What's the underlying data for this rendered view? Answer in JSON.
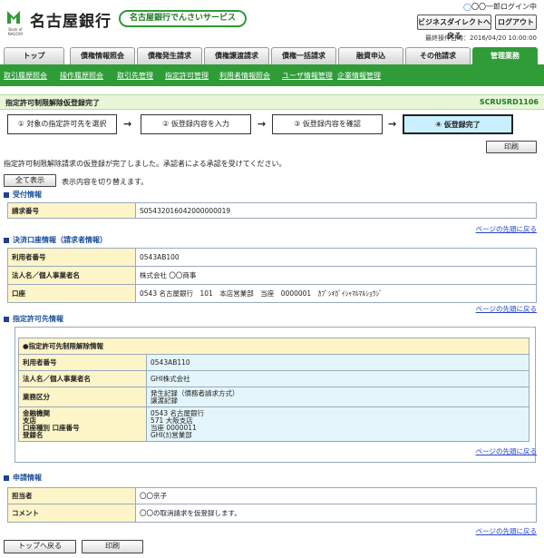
{
  "header": {
    "bank_name": "名古屋銀行",
    "logo_sub": "Bank of NAGOYA",
    "service_name": "名古屋銀行でんさいサービス",
    "user_label": "〇〇一郎ログイン中",
    "business_direct_btn": "ビジネスダイレクトへ戻る",
    "logout_btn": "ログアウト",
    "last_op": "最終操作日時：2016/04/20 10:00:00"
  },
  "tabs": [
    "トップ",
    "債権情報照会",
    "債権発生請求",
    "債権譲渡請求",
    "債権一括請求",
    "融資申込",
    "その他請求",
    "管理業務"
  ],
  "subnav": [
    "取引履歴照会",
    "操作履歴照会",
    "取引先管理",
    "指定許可管理",
    "利用者情報照会",
    "ユーザ情報管理",
    "企業情報管理"
  ],
  "title": {
    "text": "指定許可制限解除仮登録完了",
    "code": "SCRUSRD1106"
  },
  "steps": [
    "① 対象の指定許可先を選択",
    "② 仮登録内容を入力",
    "③ 仮登録内容を確認",
    "④ 仮登録完了"
  ],
  "print_label": "印刷",
  "message": "指定許可制限解除請求の仮登録が完了しました。承認者による承認を受けてください。",
  "show_all_btn": "全て表示",
  "show_all_note": "表示内容を切り替えます。",
  "page_top_link": "ページの先頭に戻る",
  "reception": {
    "heading": "受付情報",
    "rows": [
      {
        "k": "請求番号",
        "v": "S05432016042000000019"
      }
    ]
  },
  "account": {
    "heading": "決済口座情報（請求者情報）",
    "rows": [
      {
        "k": "利用者番号",
        "v": "0543AB100"
      },
      {
        "k": "法人名／個人事業者名",
        "v": "株式会社 〇〇商事"
      },
      {
        "k": "口座",
        "v": "0543 名古屋銀行　101　本店営業部　当座　0000001　ｶﾌﾞｼｷｶﾞｲｼｬﾏﾙﾏﾙｼｮｳｼﾞ"
      }
    ]
  },
  "permit": {
    "heading": "指定許可先情報",
    "box_title": "●指定許可先制限解除情報",
    "user_no_k": "利用者番号",
    "user_no_v": "0543AB110",
    "corp_k": "法人名／個人事業者名",
    "corp_v": "GHI株式会社",
    "type_k": "業務区分",
    "type_v1": "発生記録（債務者請求方式）",
    "type_v2": "譲渡記録",
    "fin_k1": "金融機関",
    "fin_k2": "支店",
    "fin_k3": "口座種別 口座番号",
    "fin_k4": "登録名",
    "fin_v1": "0543 名古屋銀行",
    "fin_v2": "571 大阪支店",
    "fin_v3": "当座 0000011",
    "fin_v4": "GHI(ｶ)営業部"
  },
  "apply": {
    "heading": "申請情報",
    "rows": [
      {
        "k": "担当者",
        "v": "〇〇京子"
      },
      {
        "k": "コメント",
        "v": "〇〇の取消請求を仮登録します。"
      }
    ]
  },
  "footer": {
    "back_top_btn": "トップへ戻る",
    "print_btn": "印刷"
  }
}
